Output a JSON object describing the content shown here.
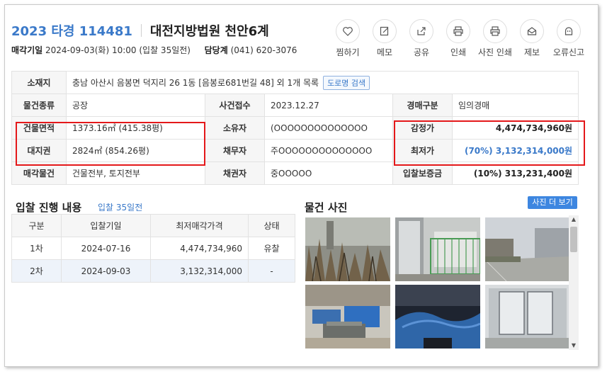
{
  "header": {
    "case_no": "2023 타경 114481",
    "court": "대전지방법원 천안6계",
    "sale_date_label": "매각기일",
    "sale_date_value": "2024-09-03(화) 10:00 (입찰 35일전)",
    "dept_label": "담당계",
    "dept_value": "(041) 620-3076"
  },
  "actions": [
    {
      "label": "찜하기",
      "icon": "heart-icon"
    },
    {
      "label": "메모",
      "icon": "memo-icon"
    },
    {
      "label": "공유",
      "icon": "share-icon"
    },
    {
      "label": "인쇄",
      "icon": "print-icon"
    },
    {
      "label": "사진 인쇄",
      "icon": "photo-print-icon"
    },
    {
      "label": "제보",
      "icon": "report-icon"
    },
    {
      "label": "오류신고",
      "icon": "error-report-icon"
    }
  ],
  "info": {
    "location_label": "소재지",
    "location_value": "충남 아산시 음봉면 덕지리 26 1동 [음봉로681번길 48] 외 1개 목록",
    "road_search": "도로명 검색",
    "type_label": "물건종류",
    "type_value": "공장",
    "received_label": "사건접수",
    "received_value": "2023.12.27",
    "auction_type_label": "경매구분",
    "auction_type_value": "임의경매",
    "building_area_label": "건물면적",
    "building_area_value": "1373.16㎡ (415.38평)",
    "owner_label": "소유자",
    "owner_value": "(OOOOOOOOOOOOOO",
    "appraisal_label": "감정가",
    "appraisal_value": "4,474,734,960원",
    "land_right_label": "대지권",
    "land_right_value": "2824㎡ (854.26평)",
    "debtor_label": "채무자",
    "debtor_value": "주OOOOOOOOOOOOOO",
    "min_price_label": "최저가",
    "min_price_value": "(70%) 3,132,314,000원",
    "sale_item_label": "매각물건",
    "sale_item_value": "건물전부, 토지전부",
    "creditor_label": "채권자",
    "creditor_value": "중OOOOO",
    "deposit_label": "입찰보증금",
    "deposit_value": "(10%) 313,231,400원"
  },
  "bidding": {
    "title": "입찰 진행 내용",
    "subtitle": "입찰 35일전",
    "columns": [
      "구분",
      "입찰기일",
      "최저매각가격",
      "상태"
    ],
    "rows": [
      [
        "1차",
        "2024-07-16",
        "4,474,734,960",
        "유찰"
      ],
      [
        "2차",
        "2024-09-03",
        "3,132,314,000",
        "-"
      ]
    ]
  },
  "photos": {
    "title": "물건 사진",
    "more_button": "사진 더 보기",
    "items": [
      "photo-dry-bushes",
      "photo-gate-fence",
      "photo-road-warehouse",
      "photo-machine-interior",
      "photo-blue-covered-machines",
      "photo-glass-door-interior"
    ]
  },
  "colors": {
    "accent": "#3a79c9",
    "highlight_border": "#e4181a",
    "header_cell_bg": "#f6f6f6"
  }
}
